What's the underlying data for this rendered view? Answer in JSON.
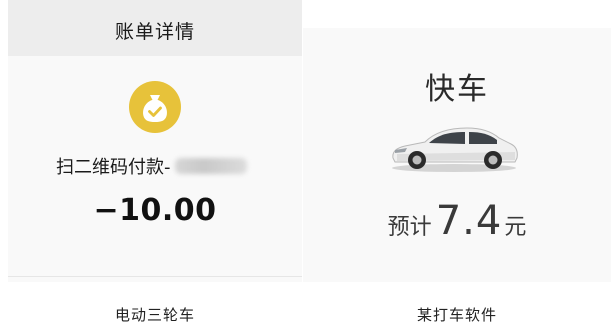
{
  "left_screen": {
    "header_title": "账单详情",
    "icon": "money-bag-icon",
    "title": "扫二维码付款-",
    "merchant_name_blurred": true,
    "amount": "−10.00",
    "colors": {
      "header_bg": "#ededed",
      "icon_bg": "#e7c23a"
    }
  },
  "right_screen": {
    "title": "快车",
    "car_icon": "white-hatchback-car",
    "price_prefix": "预计",
    "price_value": "7.4",
    "price_unit": "元"
  },
  "captions": {
    "left": "电动三轮车",
    "right": "某打车软件"
  }
}
